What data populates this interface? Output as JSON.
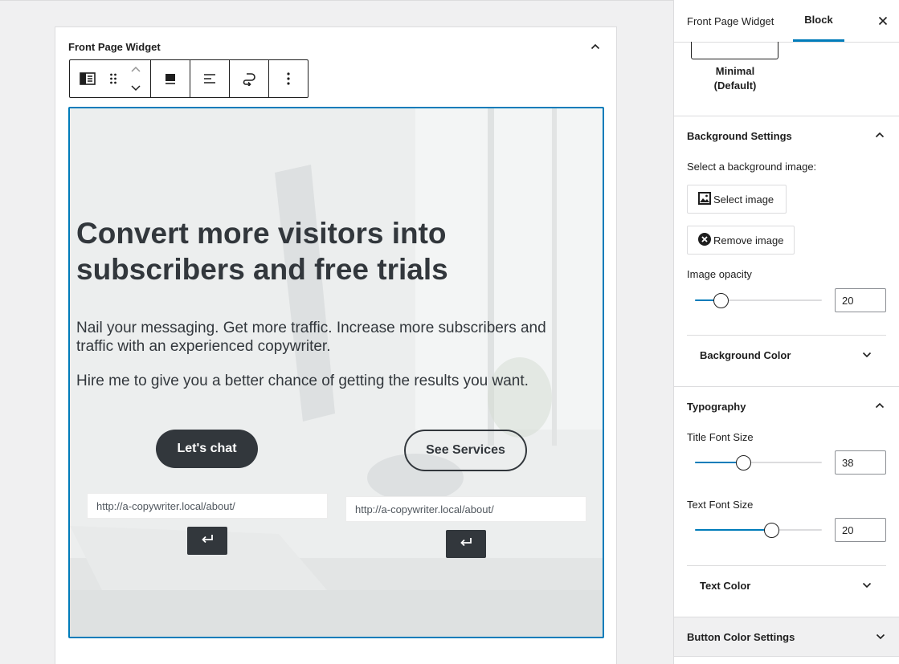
{
  "editor": {
    "widget_title": "Front Page Widget",
    "toolbar": {
      "items": [
        "block-type-icon",
        "drag-handle-icon",
        "move-up-icon",
        "move-down-icon",
        "align-full-icon",
        "align-left-text-icon",
        "link-icon",
        "more-options-icon"
      ]
    },
    "hero": {
      "title": "Convert more visitors into subscribers and free trials",
      "text1": "Nail your messaging. Get more traffic. Increase more subscribers and traffic with an experienced copywriter.",
      "text2": "Hire me to give you a better chance of getting the results you want.",
      "primary_button": "Let's chat",
      "secondary_button": "See Services",
      "primary_url": "http://a-copywriter.local/about/",
      "secondary_url": "http://a-copywriter.local/about/"
    }
  },
  "sidebar": {
    "tabs": {
      "widget": "Front Page Widget",
      "block": "Block"
    },
    "style_option": "Minimal (Default)",
    "background": {
      "header": "Background Settings",
      "select_label": "Select a background image:",
      "select_button": "Select image",
      "remove_button": "Remove image",
      "opacity_label": "Image opacity",
      "opacity_value": "20",
      "opacity_fraction": 0.2,
      "color_header": "Background Color"
    },
    "typography": {
      "header": "Typography",
      "title_size_label": "Title Font Size",
      "title_size_value": "38",
      "title_size_fraction": 0.38,
      "text_size_label": "Text Font Size",
      "text_size_value": "20",
      "text_size_fraction": 0.6,
      "text_color_header": "Text Color"
    },
    "button_colors_header": "Button Color Settings"
  },
  "colors": {
    "accent": "#007cba",
    "dark": "#32373c",
    "border": "#dcdcde"
  }
}
